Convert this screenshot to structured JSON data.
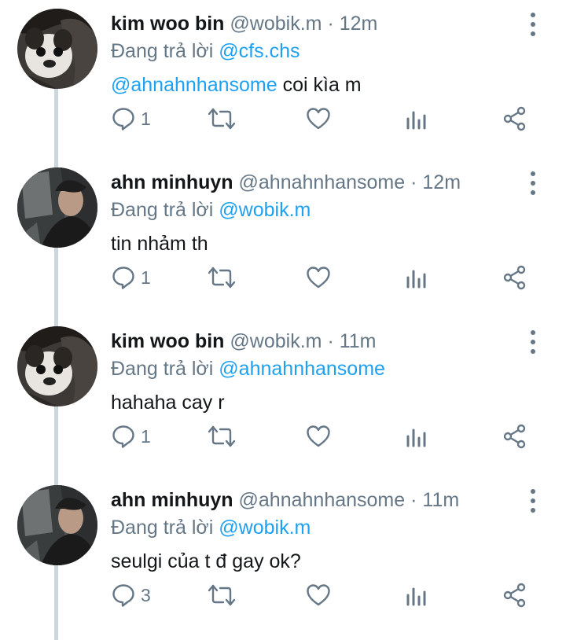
{
  "tweets": [
    {
      "name": "kim woo bin",
      "handle": "@wobik.m",
      "separator": "·",
      "time": "12m",
      "replying_label": "Đang trả lời",
      "replying_to": "@cfs.chs",
      "mention": "@ahnahnhansome",
      "text": " coi kìa m",
      "reply_count": "1",
      "avatar": "dog-avatar"
    },
    {
      "name": "ahn minhuyn",
      "handle": "@ahnahnhansome",
      "separator": "·",
      "time": "12m",
      "replying_label": "Đang trả lời",
      "replying_to": "@wobik.m",
      "mention": "",
      "text": "tin nhảm th",
      "reply_count": "1",
      "avatar": "person-avatar"
    },
    {
      "name": "kim woo bin",
      "handle": "@wobik.m",
      "separator": "·",
      "time": "11m",
      "replying_label": "Đang trả lời",
      "replying_to": "@ahnahnhansome",
      "mention": "",
      "text": "hahaha cay r",
      "reply_count": "1",
      "avatar": "dog-avatar"
    },
    {
      "name": "ahn minhuyn",
      "handle": "@ahnahnhansome",
      "separator": "·",
      "time": "11m",
      "replying_label": "Đang trả lời",
      "replying_to": "@wobik.m",
      "mention": "",
      "text": "seulgi của t đ gay ok?",
      "reply_count": "3",
      "avatar": "person-avatar"
    }
  ],
  "colors": {
    "accent": "#1da1f2",
    "muted": "#657786",
    "text": "#14171a",
    "thread_line": "#ccd6dd"
  }
}
